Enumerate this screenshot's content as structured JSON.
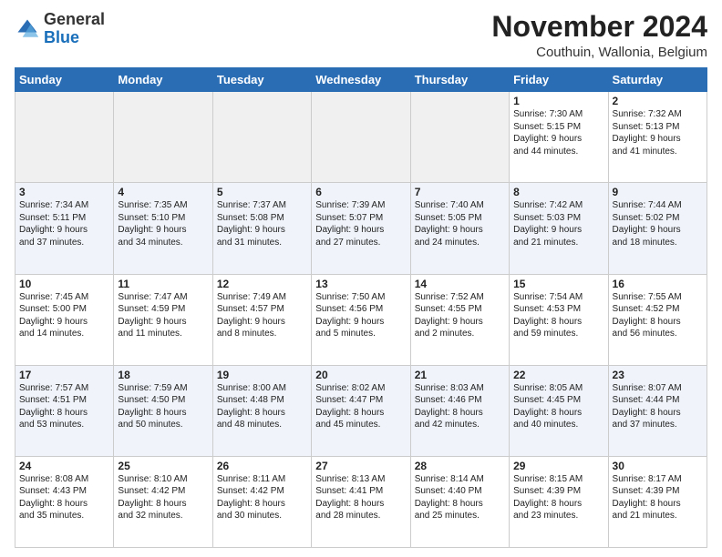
{
  "logo": {
    "general": "General",
    "blue": "Blue"
  },
  "title": "November 2024",
  "location": "Couthuin, Wallonia, Belgium",
  "days_of_week": [
    "Sunday",
    "Monday",
    "Tuesday",
    "Wednesday",
    "Thursday",
    "Friday",
    "Saturday"
  ],
  "weeks": [
    [
      {
        "day": "",
        "info": ""
      },
      {
        "day": "",
        "info": ""
      },
      {
        "day": "",
        "info": ""
      },
      {
        "day": "",
        "info": ""
      },
      {
        "day": "",
        "info": ""
      },
      {
        "day": "1",
        "info": "Sunrise: 7:30 AM\nSunset: 5:15 PM\nDaylight: 9 hours\nand 44 minutes."
      },
      {
        "day": "2",
        "info": "Sunrise: 7:32 AM\nSunset: 5:13 PM\nDaylight: 9 hours\nand 41 minutes."
      }
    ],
    [
      {
        "day": "3",
        "info": "Sunrise: 7:34 AM\nSunset: 5:11 PM\nDaylight: 9 hours\nand 37 minutes."
      },
      {
        "day": "4",
        "info": "Sunrise: 7:35 AM\nSunset: 5:10 PM\nDaylight: 9 hours\nand 34 minutes."
      },
      {
        "day": "5",
        "info": "Sunrise: 7:37 AM\nSunset: 5:08 PM\nDaylight: 9 hours\nand 31 minutes."
      },
      {
        "day": "6",
        "info": "Sunrise: 7:39 AM\nSunset: 5:07 PM\nDaylight: 9 hours\nand 27 minutes."
      },
      {
        "day": "7",
        "info": "Sunrise: 7:40 AM\nSunset: 5:05 PM\nDaylight: 9 hours\nand 24 minutes."
      },
      {
        "day": "8",
        "info": "Sunrise: 7:42 AM\nSunset: 5:03 PM\nDaylight: 9 hours\nand 21 minutes."
      },
      {
        "day": "9",
        "info": "Sunrise: 7:44 AM\nSunset: 5:02 PM\nDaylight: 9 hours\nand 18 minutes."
      }
    ],
    [
      {
        "day": "10",
        "info": "Sunrise: 7:45 AM\nSunset: 5:00 PM\nDaylight: 9 hours\nand 14 minutes."
      },
      {
        "day": "11",
        "info": "Sunrise: 7:47 AM\nSunset: 4:59 PM\nDaylight: 9 hours\nand 11 minutes."
      },
      {
        "day": "12",
        "info": "Sunrise: 7:49 AM\nSunset: 4:57 PM\nDaylight: 9 hours\nand 8 minutes."
      },
      {
        "day": "13",
        "info": "Sunrise: 7:50 AM\nSunset: 4:56 PM\nDaylight: 9 hours\nand 5 minutes."
      },
      {
        "day": "14",
        "info": "Sunrise: 7:52 AM\nSunset: 4:55 PM\nDaylight: 9 hours\nand 2 minutes."
      },
      {
        "day": "15",
        "info": "Sunrise: 7:54 AM\nSunset: 4:53 PM\nDaylight: 8 hours\nand 59 minutes."
      },
      {
        "day": "16",
        "info": "Sunrise: 7:55 AM\nSunset: 4:52 PM\nDaylight: 8 hours\nand 56 minutes."
      }
    ],
    [
      {
        "day": "17",
        "info": "Sunrise: 7:57 AM\nSunset: 4:51 PM\nDaylight: 8 hours\nand 53 minutes."
      },
      {
        "day": "18",
        "info": "Sunrise: 7:59 AM\nSunset: 4:50 PM\nDaylight: 8 hours\nand 50 minutes."
      },
      {
        "day": "19",
        "info": "Sunrise: 8:00 AM\nSunset: 4:48 PM\nDaylight: 8 hours\nand 48 minutes."
      },
      {
        "day": "20",
        "info": "Sunrise: 8:02 AM\nSunset: 4:47 PM\nDaylight: 8 hours\nand 45 minutes."
      },
      {
        "day": "21",
        "info": "Sunrise: 8:03 AM\nSunset: 4:46 PM\nDaylight: 8 hours\nand 42 minutes."
      },
      {
        "day": "22",
        "info": "Sunrise: 8:05 AM\nSunset: 4:45 PM\nDaylight: 8 hours\nand 40 minutes."
      },
      {
        "day": "23",
        "info": "Sunrise: 8:07 AM\nSunset: 4:44 PM\nDaylight: 8 hours\nand 37 minutes."
      }
    ],
    [
      {
        "day": "24",
        "info": "Sunrise: 8:08 AM\nSunset: 4:43 PM\nDaylight: 8 hours\nand 35 minutes."
      },
      {
        "day": "25",
        "info": "Sunrise: 8:10 AM\nSunset: 4:42 PM\nDaylight: 8 hours\nand 32 minutes."
      },
      {
        "day": "26",
        "info": "Sunrise: 8:11 AM\nSunset: 4:42 PM\nDaylight: 8 hours\nand 30 minutes."
      },
      {
        "day": "27",
        "info": "Sunrise: 8:13 AM\nSunset: 4:41 PM\nDaylight: 8 hours\nand 28 minutes."
      },
      {
        "day": "28",
        "info": "Sunrise: 8:14 AM\nSunset: 4:40 PM\nDaylight: 8 hours\nand 25 minutes."
      },
      {
        "day": "29",
        "info": "Sunrise: 8:15 AM\nSunset: 4:39 PM\nDaylight: 8 hours\nand 23 minutes."
      },
      {
        "day": "30",
        "info": "Sunrise: 8:17 AM\nSunset: 4:39 PM\nDaylight: 8 hours\nand 21 minutes."
      }
    ]
  ]
}
